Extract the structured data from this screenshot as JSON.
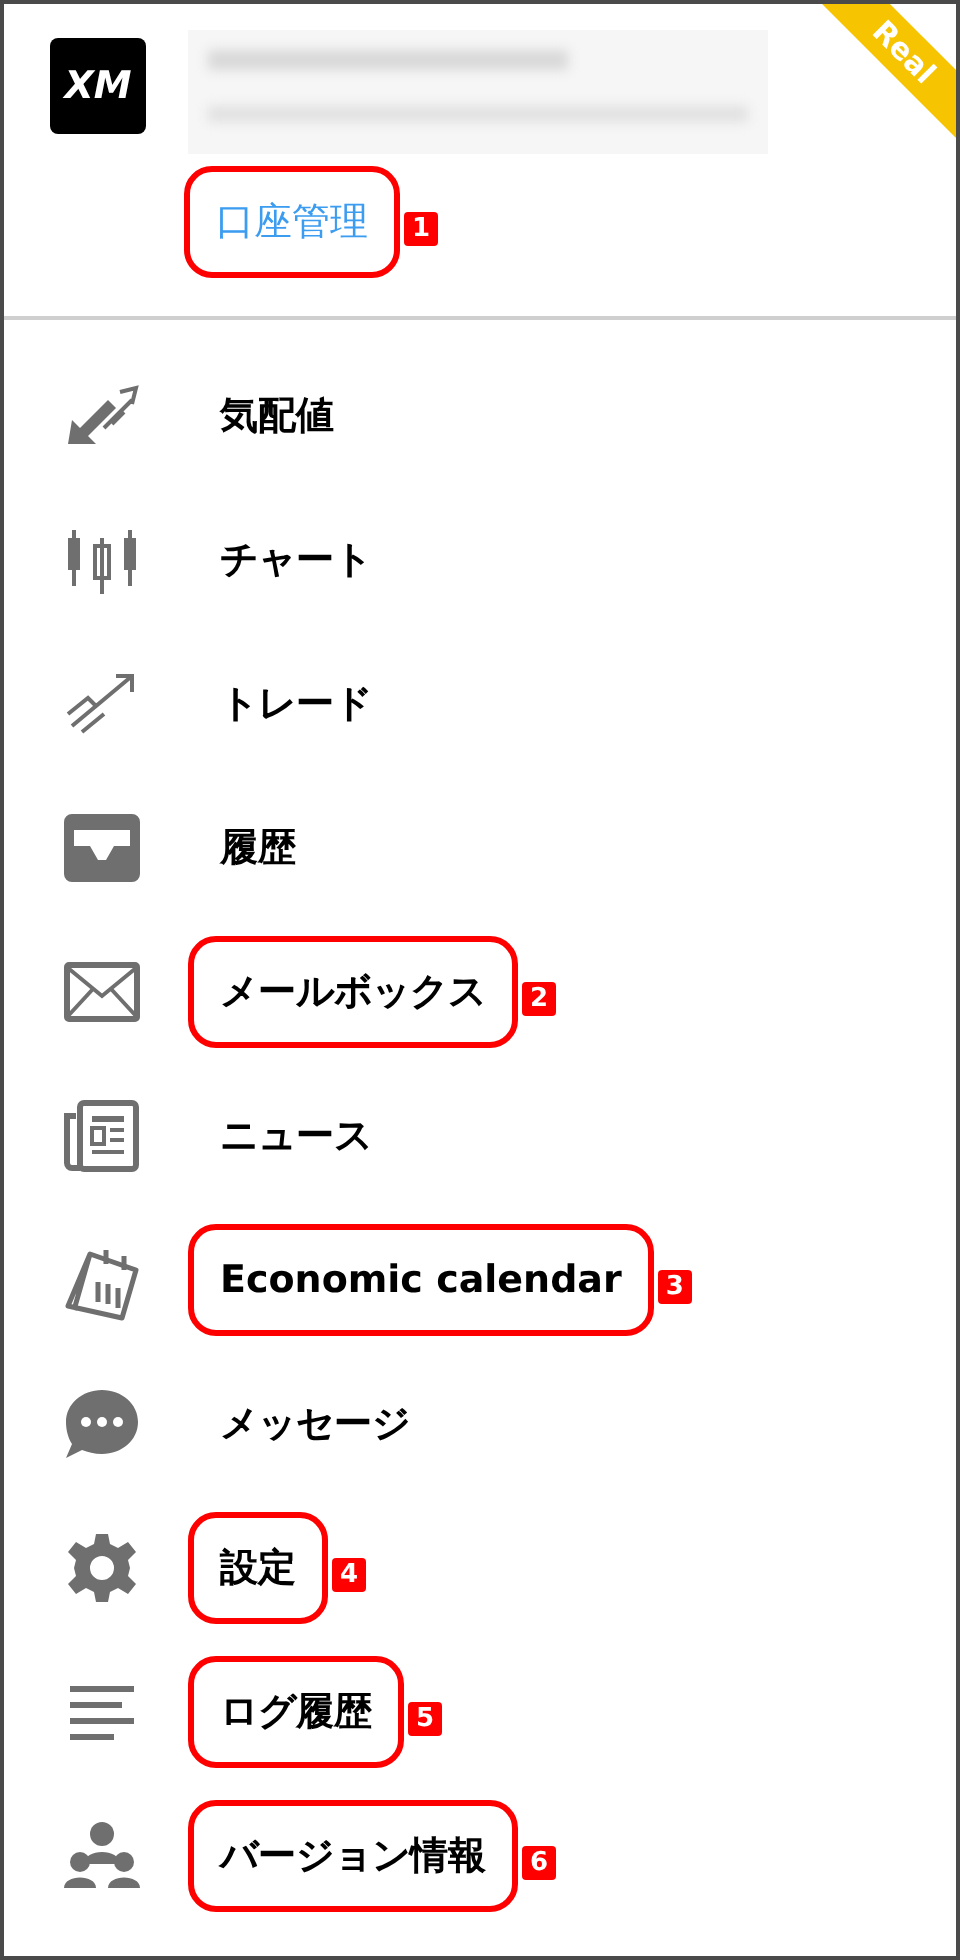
{
  "header": {
    "logo": "XM",
    "ribbon": "Real",
    "account_link": {
      "label": "口座管理",
      "annotation": "1"
    }
  },
  "menu": [
    {
      "kind": "quotes",
      "label": "気配値"
    },
    {
      "kind": "chart",
      "label": "チャート"
    },
    {
      "kind": "trade",
      "label": "トレード"
    },
    {
      "kind": "history",
      "label": "履歴"
    },
    {
      "kind": "mail",
      "label": "メールボックス",
      "annotation": "2"
    },
    {
      "kind": "news",
      "label": "ニュース"
    },
    {
      "kind": "calendar",
      "label": "Economic calendar",
      "annotation": "3"
    },
    {
      "kind": "chat",
      "label": "メッセージ"
    },
    {
      "kind": "settings",
      "label": "設定",
      "annotation": "4"
    },
    {
      "kind": "journal",
      "label": "ログ履歴",
      "annotation": "5"
    },
    {
      "kind": "about",
      "label": "バージョン情報",
      "annotation": "6"
    }
  ]
}
